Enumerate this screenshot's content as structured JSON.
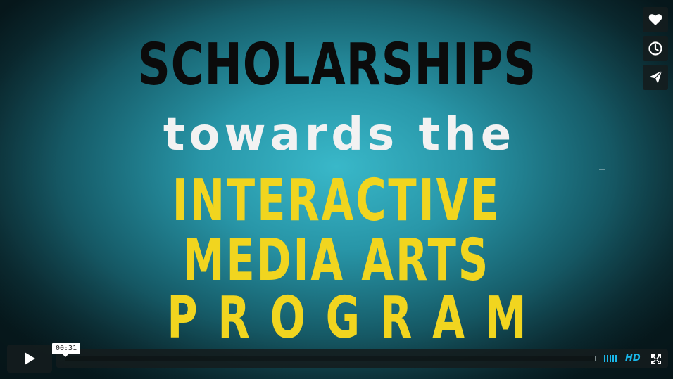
{
  "video": {
    "title_lines": [
      "SCHOLARSHIPS",
      "towards the",
      "INTERACTIVE",
      "MEDIA ARTS",
      "PROGRAM"
    ]
  },
  "side_buttons": {
    "like_icon": "heart-icon",
    "watch_later_icon": "clock-icon",
    "share_icon": "paper-plane-icon"
  },
  "player_controls": {
    "play_icon": "play-icon",
    "timecode": "00:31",
    "progress": 0.0,
    "volume_icon": "volume-bars-icon",
    "hd_label": "HD",
    "fullscreen_icon": "fullscreen-icon"
  },
  "colors": {
    "accent": "#19b7ea",
    "title_black": "#0b0b0b",
    "title_white": "#f2f2f2",
    "title_yellow": "#f1d51f",
    "background_center": "#39b8c9",
    "background_edge": "#0c2e35"
  }
}
